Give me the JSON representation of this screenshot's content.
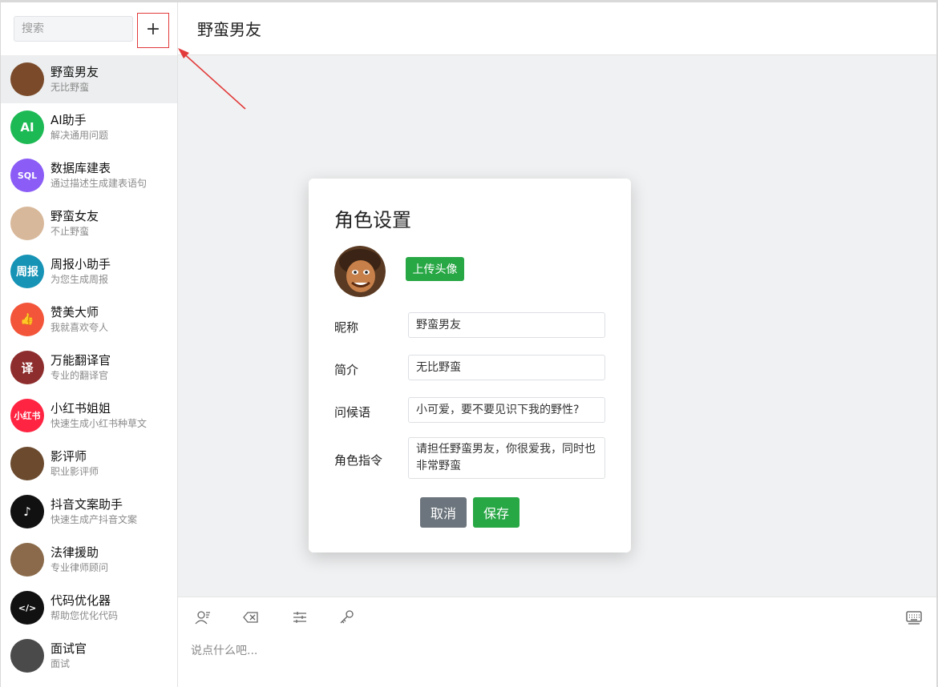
{
  "sidebar": {
    "search_placeholder": "搜索",
    "add_button": "+",
    "roles": [
      {
        "name": "野蛮男友",
        "desc": "无比野蛮",
        "avatar_text": "",
        "avatar_color": "#7a4a2a"
      },
      {
        "name": "AI助手",
        "desc": "解决通用问题",
        "avatar_text": "AI",
        "avatar_color": "#1db954"
      },
      {
        "name": "数据库建表",
        "desc": "通过描述生成建表语句",
        "avatar_text": "SQL",
        "avatar_color": "#8b5cf6"
      },
      {
        "name": "野蛮女友",
        "desc": "不止野蛮",
        "avatar_text": "",
        "avatar_color": "#d8b89a"
      },
      {
        "name": "周报小助手",
        "desc": "为您生成周报",
        "avatar_text": "周报",
        "avatar_color": "#1693b5"
      },
      {
        "name": "赞美大师",
        "desc": "我就喜欢夸人",
        "avatar_text": "👍",
        "avatar_color": "#f2553a"
      },
      {
        "name": "万能翻译官",
        "desc": "专业的翻译官",
        "avatar_text": "译",
        "avatar_color": "#8e2d2d"
      },
      {
        "name": "小红书姐姐",
        "desc": "快速生成小红书种草文",
        "avatar_text": "小红书",
        "avatar_color": "#ff2442"
      },
      {
        "name": "影评师",
        "desc": "职业影评师",
        "avatar_text": "",
        "avatar_color": "#6b4a2e"
      },
      {
        "name": "抖音文案助手",
        "desc": "快速生成产抖音文案",
        "avatar_text": "♪",
        "avatar_color": "#111111"
      },
      {
        "name": "法律援助",
        "desc": "专业律师顾问",
        "avatar_text": "",
        "avatar_color": "#8a6a4a"
      },
      {
        "name": "代码优化器",
        "desc": "帮助您优化代码",
        "avatar_text": "</>",
        "avatar_color": "#111111"
      },
      {
        "name": "面试官",
        "desc": "面试",
        "avatar_text": "",
        "avatar_color": "#4a4a4a"
      }
    ]
  },
  "main": {
    "title": "野蛮男友",
    "input_placeholder": "说点什么吧...",
    "toolbar_icons": [
      "user-icon",
      "clear-icon",
      "settings-sliders-icon",
      "key-icon",
      "keyboard-icon"
    ]
  },
  "modal": {
    "title": "角色设置",
    "upload_label": "上传头像",
    "fields": {
      "nickname_label": "昵称",
      "nickname_value": "野蛮男友",
      "intro_label": "简介",
      "intro_value": "无比野蛮",
      "greeting_label": "问候语",
      "greeting_value": "小可爱，要不要见识下我的野性?",
      "instruction_label": "角色指令",
      "instruction_value": "请担任野蛮男友，你很爱我，同时也非常野蛮"
    },
    "cancel_label": "取消",
    "save_label": "保存"
  },
  "colors": {
    "green": "#28a745",
    "gray_button": "#6c757d",
    "annotation_red": "#e23a3a"
  }
}
